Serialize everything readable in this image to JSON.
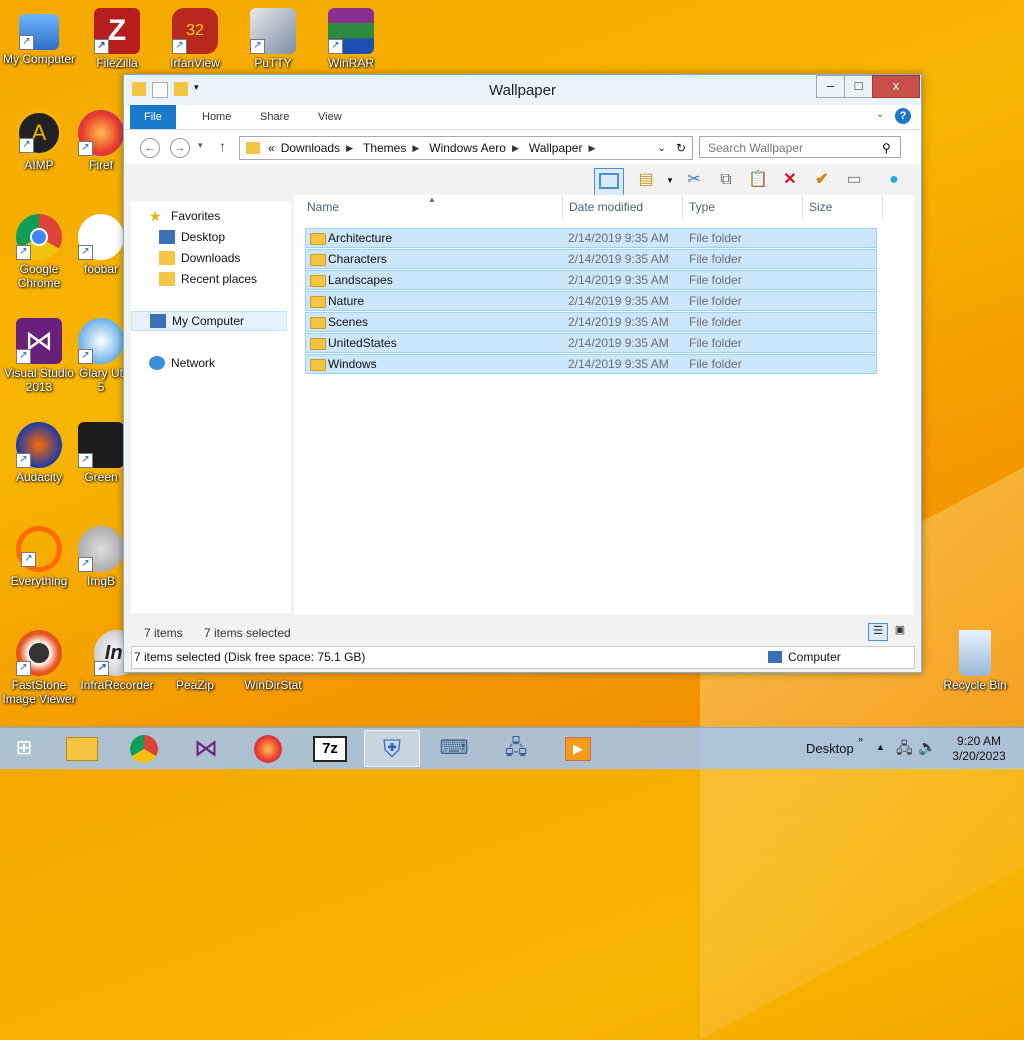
{
  "desktop": {
    "icons": [
      {
        "label": "My Computer",
        "icon": "computer-icon"
      },
      {
        "label": "FileZilla",
        "icon": "filezilla-icon"
      },
      {
        "label": "IrfanView",
        "icon": "irfanview-icon"
      },
      {
        "label": "PuTTY",
        "icon": "putty-icon"
      },
      {
        "label": "WinRAR",
        "icon": "winrar-icon"
      },
      {
        "label": "AIMP",
        "icon": "aimp-icon"
      },
      {
        "label": "Firef",
        "icon": "firefox-icon"
      },
      {
        "label": "Google Chrome",
        "icon": "chrome-icon"
      },
      {
        "label": "foobar",
        "icon": "foobar-icon"
      },
      {
        "label": "Visual Studio 2013",
        "icon": "visual-studio-icon"
      },
      {
        "label": "Glary Ut 5",
        "icon": "glary-icon"
      },
      {
        "label": "Audacity",
        "icon": "audacity-icon"
      },
      {
        "label": "Green",
        "icon": "greenshot-icon"
      },
      {
        "label": "Everything",
        "icon": "everything-icon"
      },
      {
        "label": "ImgB",
        "icon": "imgburn-icon"
      },
      {
        "label": "FastStone Image Viewer",
        "icon": "faststone-icon"
      },
      {
        "label": "InfraRecorder",
        "icon": "infrarecorder-icon"
      },
      {
        "label": "PeaZip",
        "icon": "peazip-icon"
      },
      {
        "label": "WinDirStat",
        "icon": "windirstat-icon"
      },
      {
        "label": "Recycle Bin",
        "icon": "recycle-bin-icon"
      }
    ]
  },
  "window": {
    "title": "Wallpaper",
    "controls": {
      "minimize": "–",
      "maximize": "□",
      "close": "x"
    },
    "ribbon_tabs": [
      "File",
      "Home",
      "Share",
      "View"
    ],
    "address": {
      "prefix": "«",
      "crumbs": [
        "Downloads",
        "Themes",
        "Windows Aero",
        "Wallpaper"
      ]
    },
    "search_placeholder": "Search Wallpaper",
    "nav": {
      "favorites": "Favorites",
      "desktop": "Desktop",
      "downloads": "Downloads",
      "recent": "Recent places",
      "computer": "My Computer",
      "network": "Network"
    },
    "columns": [
      "Name",
      "Date modified",
      "Type",
      "Size"
    ],
    "rows": [
      {
        "name": "Architecture",
        "date": "2/14/2019 9:35 AM",
        "type": "File folder"
      },
      {
        "name": "Characters",
        "date": "2/14/2019 9:35 AM",
        "type": "File folder"
      },
      {
        "name": "Landscapes",
        "date": "2/14/2019 9:35 AM",
        "type": "File folder"
      },
      {
        "name": "Nature",
        "date": "2/14/2019 9:35 AM",
        "type": "File folder"
      },
      {
        "name": "Scenes",
        "date": "2/14/2019 9:35 AM",
        "type": "File folder"
      },
      {
        "name": "UnitedStates",
        "date": "2/14/2019 9:35 AM",
        "type": "File folder"
      },
      {
        "name": "Windows",
        "date": "2/14/2019 9:35 AM",
        "type": "File folder"
      }
    ],
    "status": {
      "items": "7 items",
      "selected": "7 items selected",
      "bar": "7 items selected (Disk free space: 75.1 GB)",
      "location": "Computer"
    }
  },
  "taskbar": {
    "apps": [
      "start-icon",
      "explorer-icon",
      "chrome-icon",
      "visual-studio-icon",
      "firefox-icon",
      "7zip-icon",
      "security-icon",
      "keyboard-icon",
      "network-icon",
      "media-icon"
    ],
    "desktop_label": "Desktop",
    "time": "9:20 AM",
    "date": "3/20/2023"
  },
  "colors": {
    "accent": "#1979ca",
    "selection": "#cce6fb",
    "taskbar": "#a0c8f5"
  }
}
